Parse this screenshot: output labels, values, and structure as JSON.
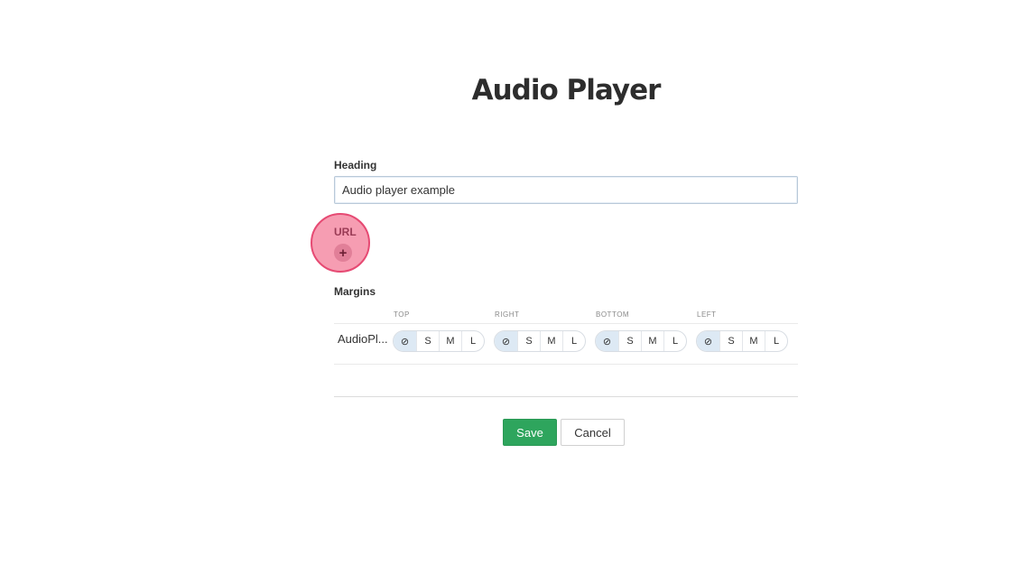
{
  "page": {
    "title": "Audio Player"
  },
  "form": {
    "heading_label": "Heading",
    "heading_value": "Audio player example",
    "url_label": "URL",
    "url_add_icon": "+",
    "margins_label": "Margins",
    "margins_columns": [
      "TOP",
      "RIGHT",
      "BOTTOM",
      "LEFT"
    ],
    "margins_row_name": "AudioPl...",
    "margin_options": [
      "⊘",
      "S",
      "M",
      "L"
    ],
    "margin_selected": "none"
  },
  "actions": {
    "save_label": "Save",
    "cancel_label": "Cancel"
  },
  "colors": {
    "save": "#2ea55d",
    "selected_option": "#dde9f4",
    "highlight": "#e64a73"
  }
}
